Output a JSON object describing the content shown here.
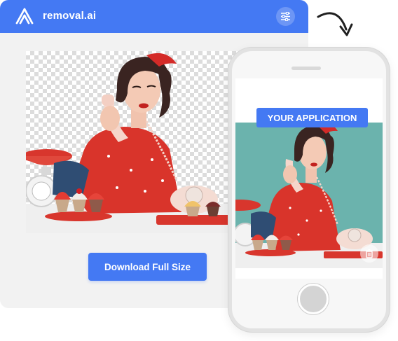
{
  "app": {
    "brand_name": "removal.ai",
    "download_label": "Download Full Size",
    "settings_icon": "sliders-icon"
  },
  "phone": {
    "badge_label": "YOUR APPLICATION",
    "trash_icon": "trash-icon"
  },
  "colors": {
    "brand_blue": "#4479f3",
    "phone_background_teal": "#6bb3ad",
    "checkerboard_gray": "#dcdcdc"
  }
}
